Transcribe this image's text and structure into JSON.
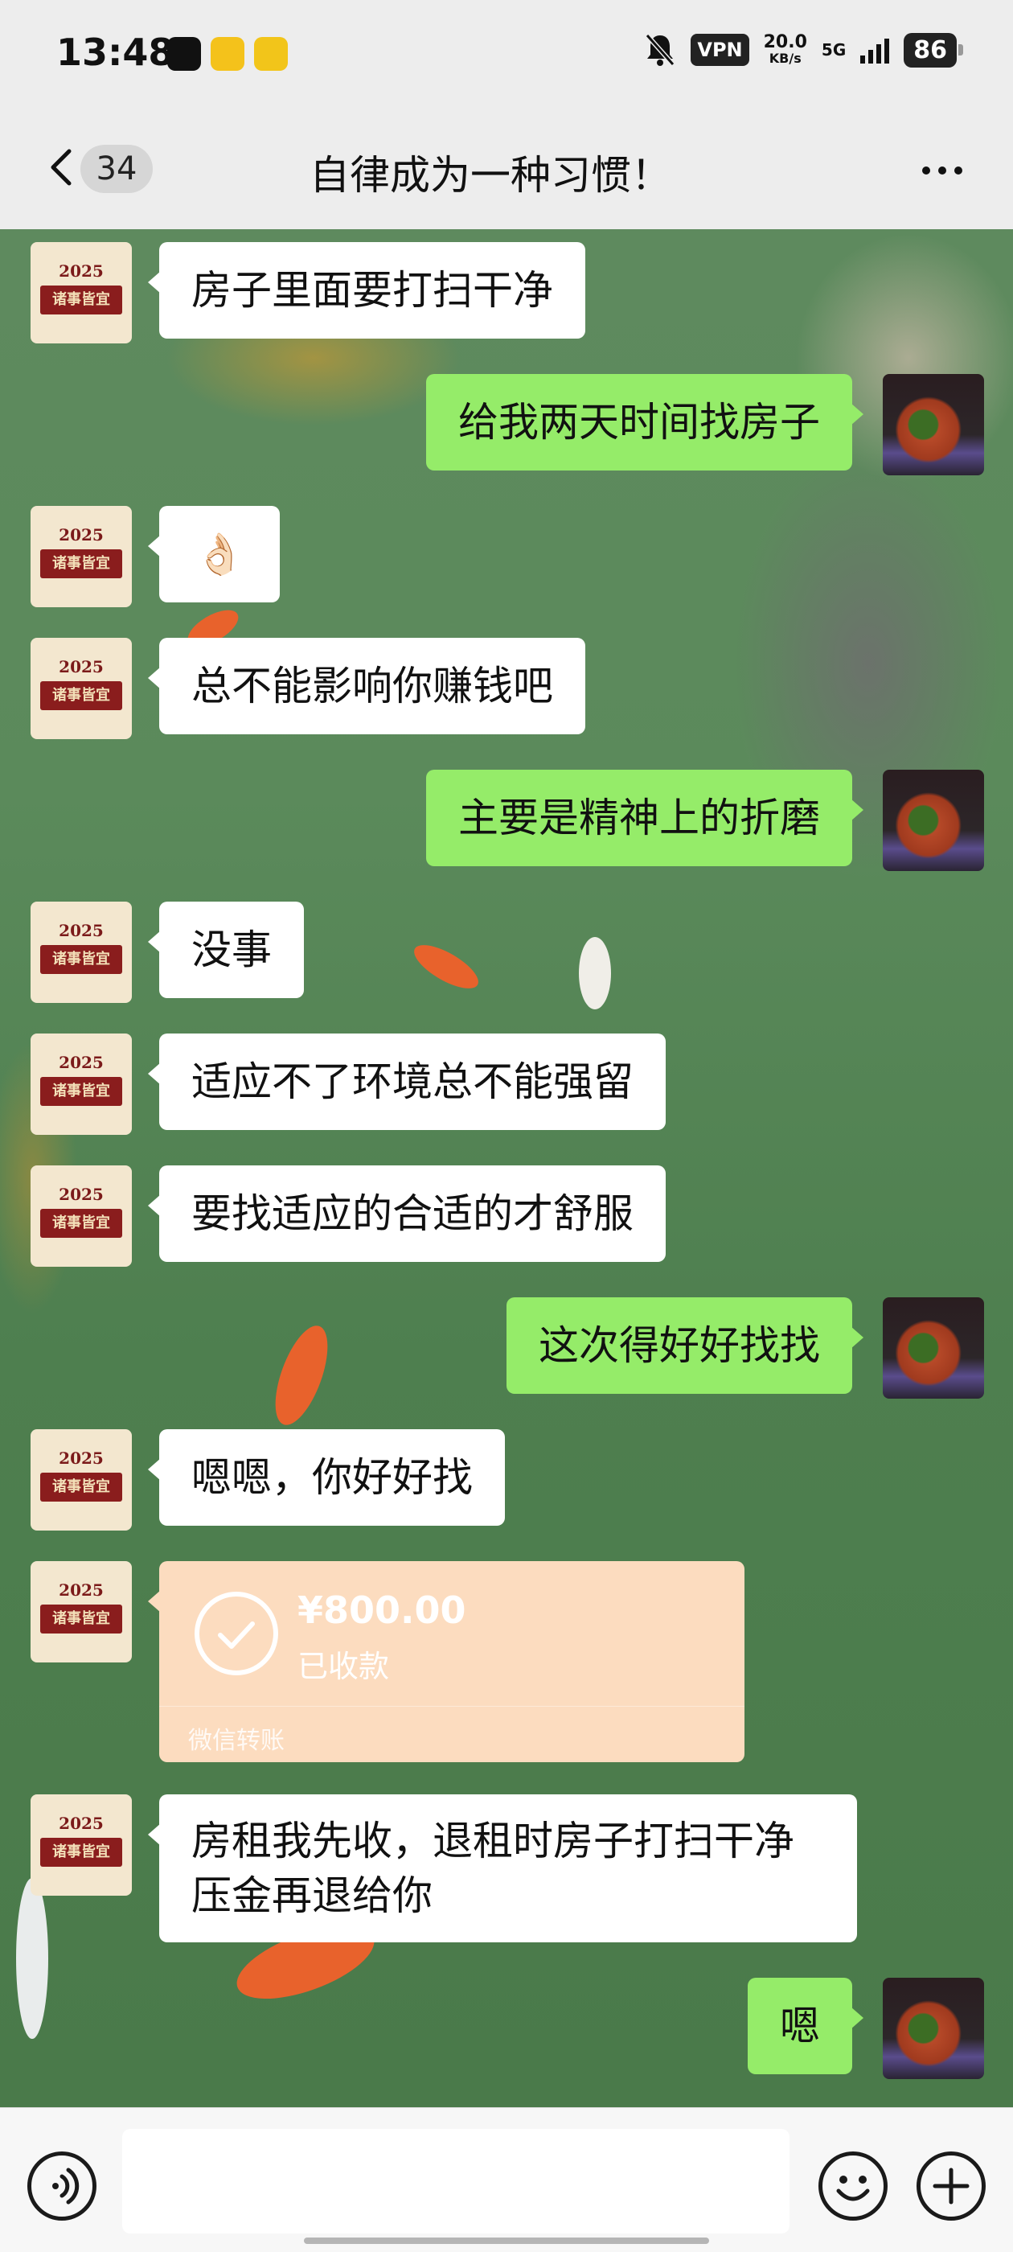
{
  "status_bar": {
    "time": "13:48",
    "app_icons": [
      "tiktok-icon",
      "duck-app-icon",
      "seven-app-icon"
    ],
    "vpn": "VPN",
    "speed_value": "20.0",
    "speed_unit": "KB/s",
    "network": "5G",
    "battery": "86"
  },
  "nav": {
    "unread_count": "34",
    "title": "自律成为一种习惯！"
  },
  "avatar_left": {
    "year": "2025",
    "text": "诸事皆宜"
  },
  "messages": [
    {
      "side": "left",
      "text": "房子里面要打扫干净"
    },
    {
      "side": "right",
      "text": "给我两天时间找房子"
    },
    {
      "side": "left",
      "text": "👌🏻"
    },
    {
      "side": "left",
      "text": "总不能影响你赚钱吧"
    },
    {
      "side": "right",
      "text": "主要是精神上的折磨"
    },
    {
      "side": "left",
      "text": "没事"
    },
    {
      "side": "left",
      "text": "适应不了环境总不能强留"
    },
    {
      "side": "left",
      "text": "要找适应的合适的才舒服"
    },
    {
      "side": "right",
      "text": "这次得好好找找"
    },
    {
      "side": "left",
      "text": "嗯嗯，你好好找"
    },
    {
      "side": "left",
      "type": "transfer",
      "amount": "¥800.00",
      "status": "已收款",
      "source": "微信转账"
    },
    {
      "side": "left",
      "text": "房租我先收，退租时房子打扫干净\n压金再退给你",
      "line1": "房租我先收，退租时房子打扫干净",
      "line2": "压金再退给你"
    },
    {
      "side": "right",
      "text": "嗯"
    }
  ],
  "input_bar": {
    "voice_icon": "voice-icon",
    "emoji_icon": "emoji-icon",
    "plus_icon": "plus-icon"
  }
}
